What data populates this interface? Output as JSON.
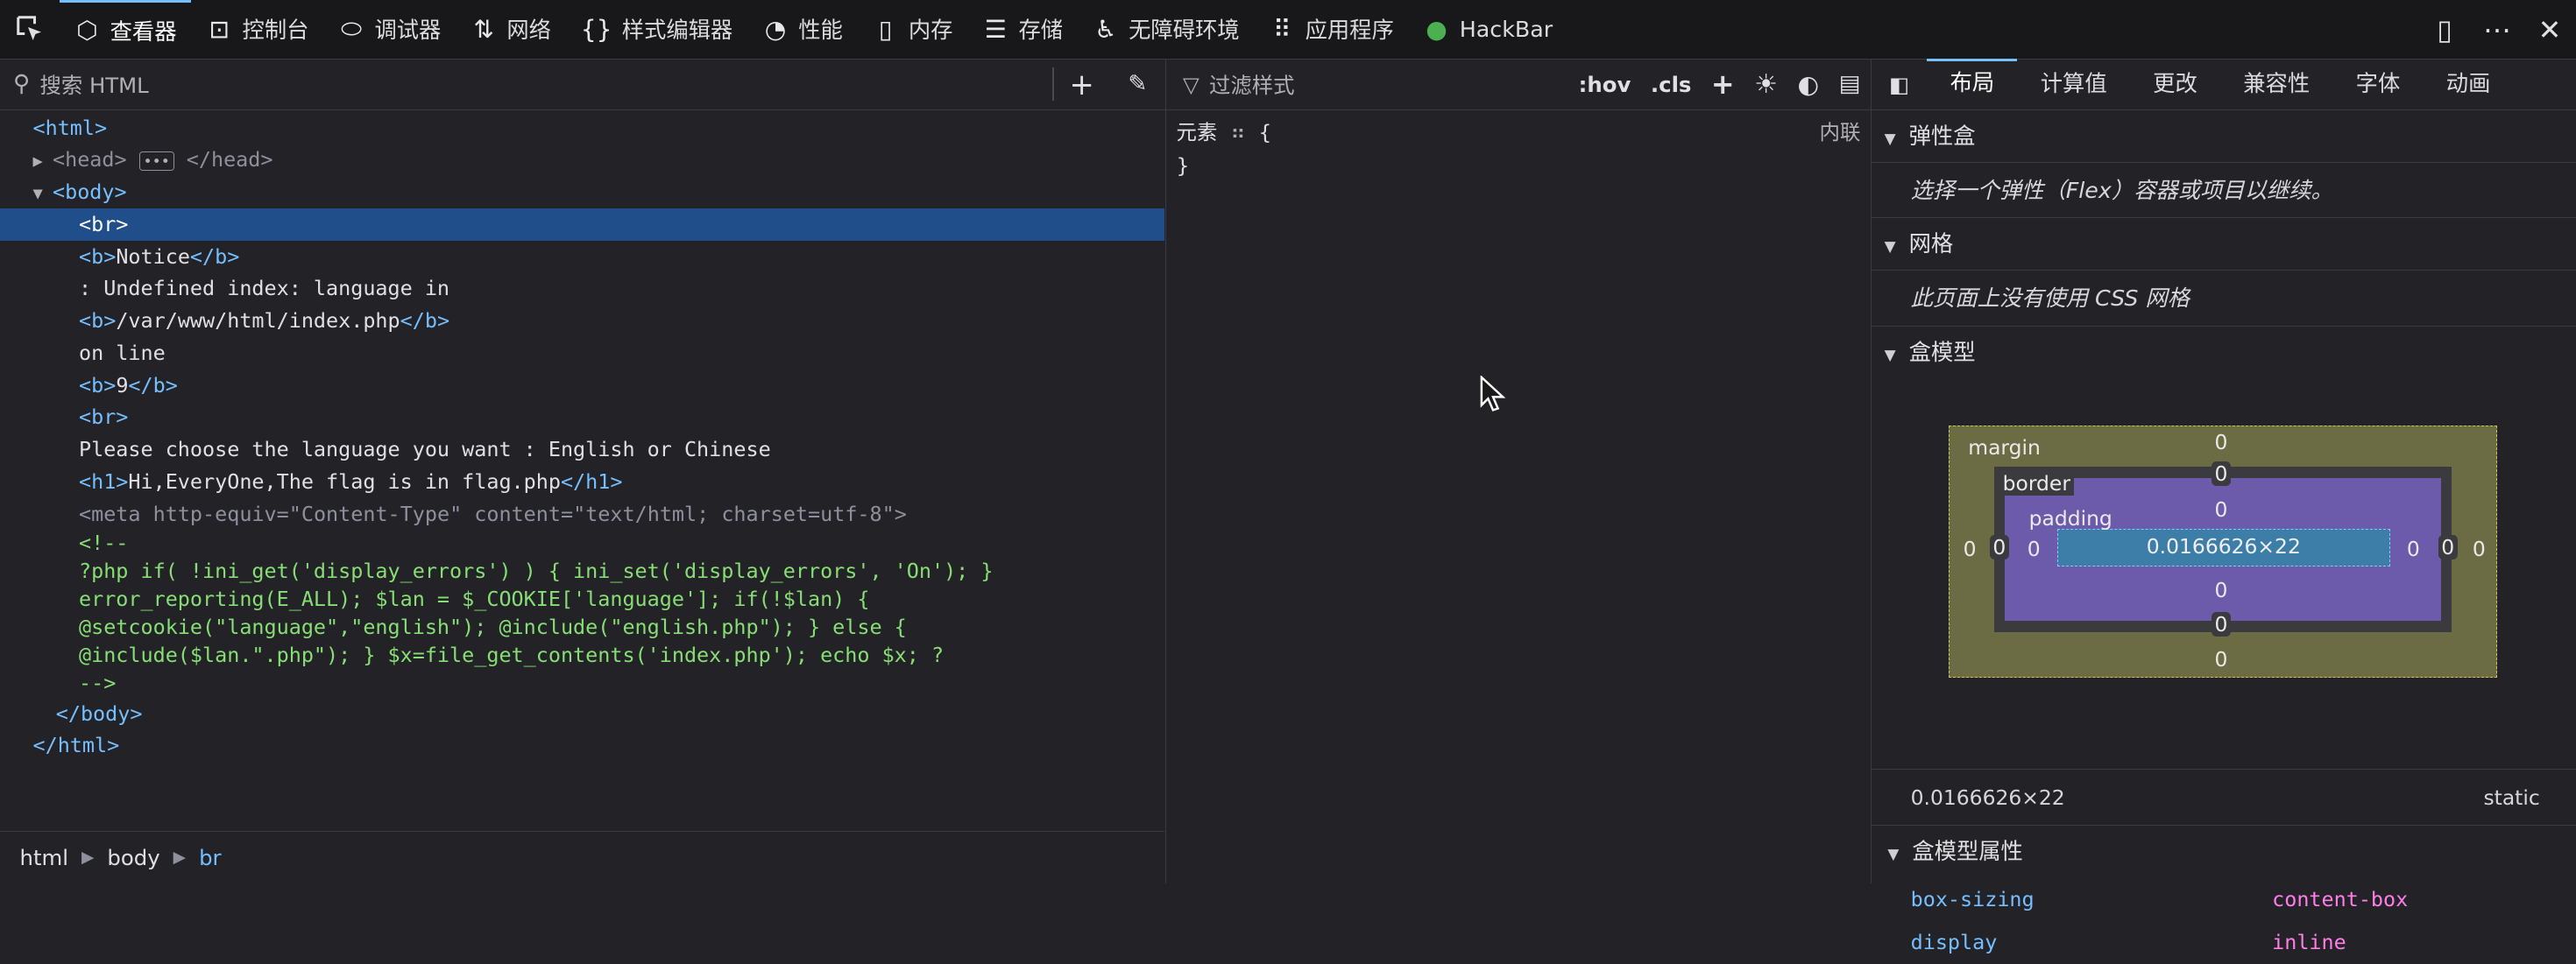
{
  "toolbar": {
    "tabs": [
      {
        "label": "查看器",
        "icon": "inspector-icon",
        "glyph": "⬡",
        "active": true
      },
      {
        "label": "控制台",
        "icon": "console-icon",
        "glyph": "⊡"
      },
      {
        "label": "调试器",
        "icon": "debugger-icon",
        "glyph": "⬭"
      },
      {
        "label": "网络",
        "icon": "network-icon",
        "glyph": "⇅"
      },
      {
        "label": "样式编辑器",
        "icon": "style-editor-icon",
        "glyph": "{}"
      },
      {
        "label": "性能",
        "icon": "performance-icon",
        "glyph": "◔"
      },
      {
        "label": "内存",
        "icon": "memory-icon",
        "glyph": "▯"
      },
      {
        "label": "存储",
        "icon": "storage-icon",
        "glyph": "☰"
      },
      {
        "label": "无障碍环境",
        "icon": "accessibility-icon",
        "glyph": "♿"
      },
      {
        "label": "应用程序",
        "icon": "application-icon",
        "glyph": "⠿"
      },
      {
        "label": "HackBar",
        "icon": "hackbar-icon",
        "glyph": "●"
      }
    ]
  },
  "inspector": {
    "search_placeholder": "搜索 HTML",
    "tree": {
      "html_open": "<html>",
      "head_line": "<head>",
      "head_close": "</head>",
      "body_open": "<body>",
      "br1": "<br>",
      "b_notice_open": "<b>",
      "notice": "Notice",
      "b_close": "</b>",
      "undefined_text": ": Undefined index: language in",
      "path": "/var/www/html/index.php",
      "on_line": "on line",
      "line_no": "9",
      "please": "Please choose the language you want : English or Chinese",
      "h1_open": "<h1>",
      "h1_text": "Hi,EveryOne,The flag is in flag.php",
      "h1_close": "</h1>",
      "meta_tag": "<meta",
      "meta_attr1": "http-equiv",
      "meta_val1": "\"Content-Type\"",
      "meta_attr2": "content",
      "meta_val2": "\"text/html; charset=utf-8\"",
      "meta_end": ">",
      "comment": "<!--\n?php if( !ini_get('display_errors') ) { ini_set('display_errors', 'On'); }\nerror_reporting(E_ALL); $lan = $_COOKIE['language']; if(!$lan) {\n@setcookie(\"language\",\"english\"); @include(\"english.php\"); } else {\n@include($lan.\".php\"); } $x=file_get_contents('index.php'); echo $x; ?\n-->",
      "body_close": "</body>",
      "html_close": "</html>"
    },
    "breadcrumbs": [
      "html",
      "body",
      "br"
    ]
  },
  "rules": {
    "filter_placeholder": "过滤样式",
    "hov": ":hov",
    "cls": ".cls",
    "element_label": "元素",
    "open_brace": "{",
    "close_brace": "}",
    "inline_label": "内联"
  },
  "layout_panel": {
    "tabs": [
      "布局",
      "计算值",
      "更改",
      "兼容性",
      "字体",
      "动画"
    ],
    "flex_header": "弹性盒",
    "flex_msg": "选择一个弹性（Flex）容器或项目以继续。",
    "grid_header": "网格",
    "grid_msg": "此页面上没有使用 CSS 网格",
    "boxmodel_header": "盒模型",
    "margin_label": "margin",
    "border_label": "border",
    "padding_label": "padding",
    "content_size": "0.0166626×22",
    "zero": "0",
    "dims": "0.0166626×22",
    "position": "static",
    "props_header": "盒模型属性",
    "props": [
      {
        "name": "box-sizing",
        "value": "content-box"
      },
      {
        "name": "display",
        "value": "inline"
      }
    ]
  }
}
